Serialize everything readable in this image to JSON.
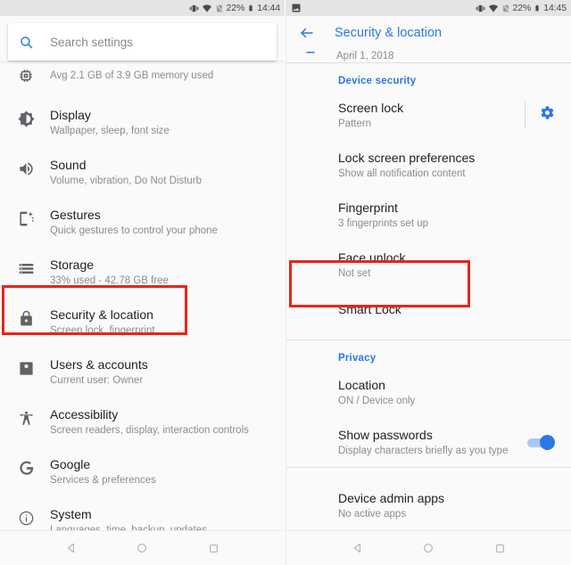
{
  "accent": "#2b78e4",
  "highlight_color": "#e8241a",
  "left": {
    "statusbar": {
      "icons": [
        "vibrate-icon",
        "wifi-icon",
        "no-sim-icon"
      ],
      "battery_percent": "22%",
      "battery_icon": "battery-icon",
      "time": "14:44"
    },
    "search": {
      "icon": "search-icon",
      "placeholder": "Search settings",
      "value": ""
    },
    "partial_item": {
      "icon": "memory-icon",
      "subtitle": "Avg 2.1 GB of 3.9 GB memory used"
    },
    "items": [
      {
        "icon": "brightness-icon",
        "title": "Display",
        "subtitle": "Wallpaper, sleep, font size"
      },
      {
        "icon": "volume-icon",
        "title": "Sound",
        "subtitle": "Volume, vibration, Do Not Disturb"
      },
      {
        "icon": "gestures-icon",
        "title": "Gestures",
        "subtitle": "Quick gestures to control your phone"
      },
      {
        "icon": "storage-icon",
        "title": "Storage",
        "subtitle": "33% used - 42.78 GB free"
      },
      {
        "icon": "lock-icon",
        "title": "Security & location",
        "subtitle": "Screen lock, fingerprint",
        "highlighted": true
      },
      {
        "icon": "person-icon",
        "title": "Users & accounts",
        "subtitle": "Current user: Owner"
      },
      {
        "icon": "accessibility-icon",
        "title": "Accessibility",
        "subtitle": "Screen readers, display, interaction controls"
      },
      {
        "icon": "google-icon",
        "title": "Google",
        "subtitle": "Services & preferences"
      },
      {
        "icon": "info-icon",
        "title": "System",
        "subtitle": "Languages, time, backup, updates"
      }
    ],
    "navbar": [
      "back-icon",
      "home-icon",
      "recents-icon"
    ]
  },
  "right": {
    "statusbar": {
      "notification_icon": "screenshot-icon",
      "icons": [
        "vibrate-icon",
        "wifi-icon",
        "no-sim-icon"
      ],
      "battery_percent": "22%",
      "battery_icon": "battery-icon",
      "time": "14:45"
    },
    "appbar": {
      "back_icon": "arrow-back-icon",
      "title": "Security & location"
    },
    "partial_item": {
      "icon": "update-icon",
      "subtitle": "April 1, 2018"
    },
    "sections": [
      {
        "header": "Device security",
        "items": [
          {
            "title": "Screen lock",
            "subtitle": "Pattern",
            "trailing": "gear-icon"
          },
          {
            "title": "Lock screen preferences",
            "subtitle": "Show all notification content"
          },
          {
            "title": "Fingerprint",
            "subtitle": "3 fingerprints set up"
          },
          {
            "title": "Face unlock",
            "subtitle": "Not set",
            "highlighted": true
          },
          {
            "title": "Smart Lock",
            "subtitle": ""
          }
        ]
      },
      {
        "header": "Privacy",
        "items": [
          {
            "title": "Location",
            "subtitle": "ON / Device only"
          },
          {
            "title": "Show passwords",
            "subtitle": "Display characters briefly as you type",
            "trailing": "toggle-on"
          }
        ]
      },
      {
        "header": "",
        "items": [
          {
            "title": "Device admin apps",
            "subtitle": "No active apps"
          }
        ]
      }
    ],
    "navbar": [
      "back-icon",
      "home-icon",
      "recents-icon"
    ]
  }
}
